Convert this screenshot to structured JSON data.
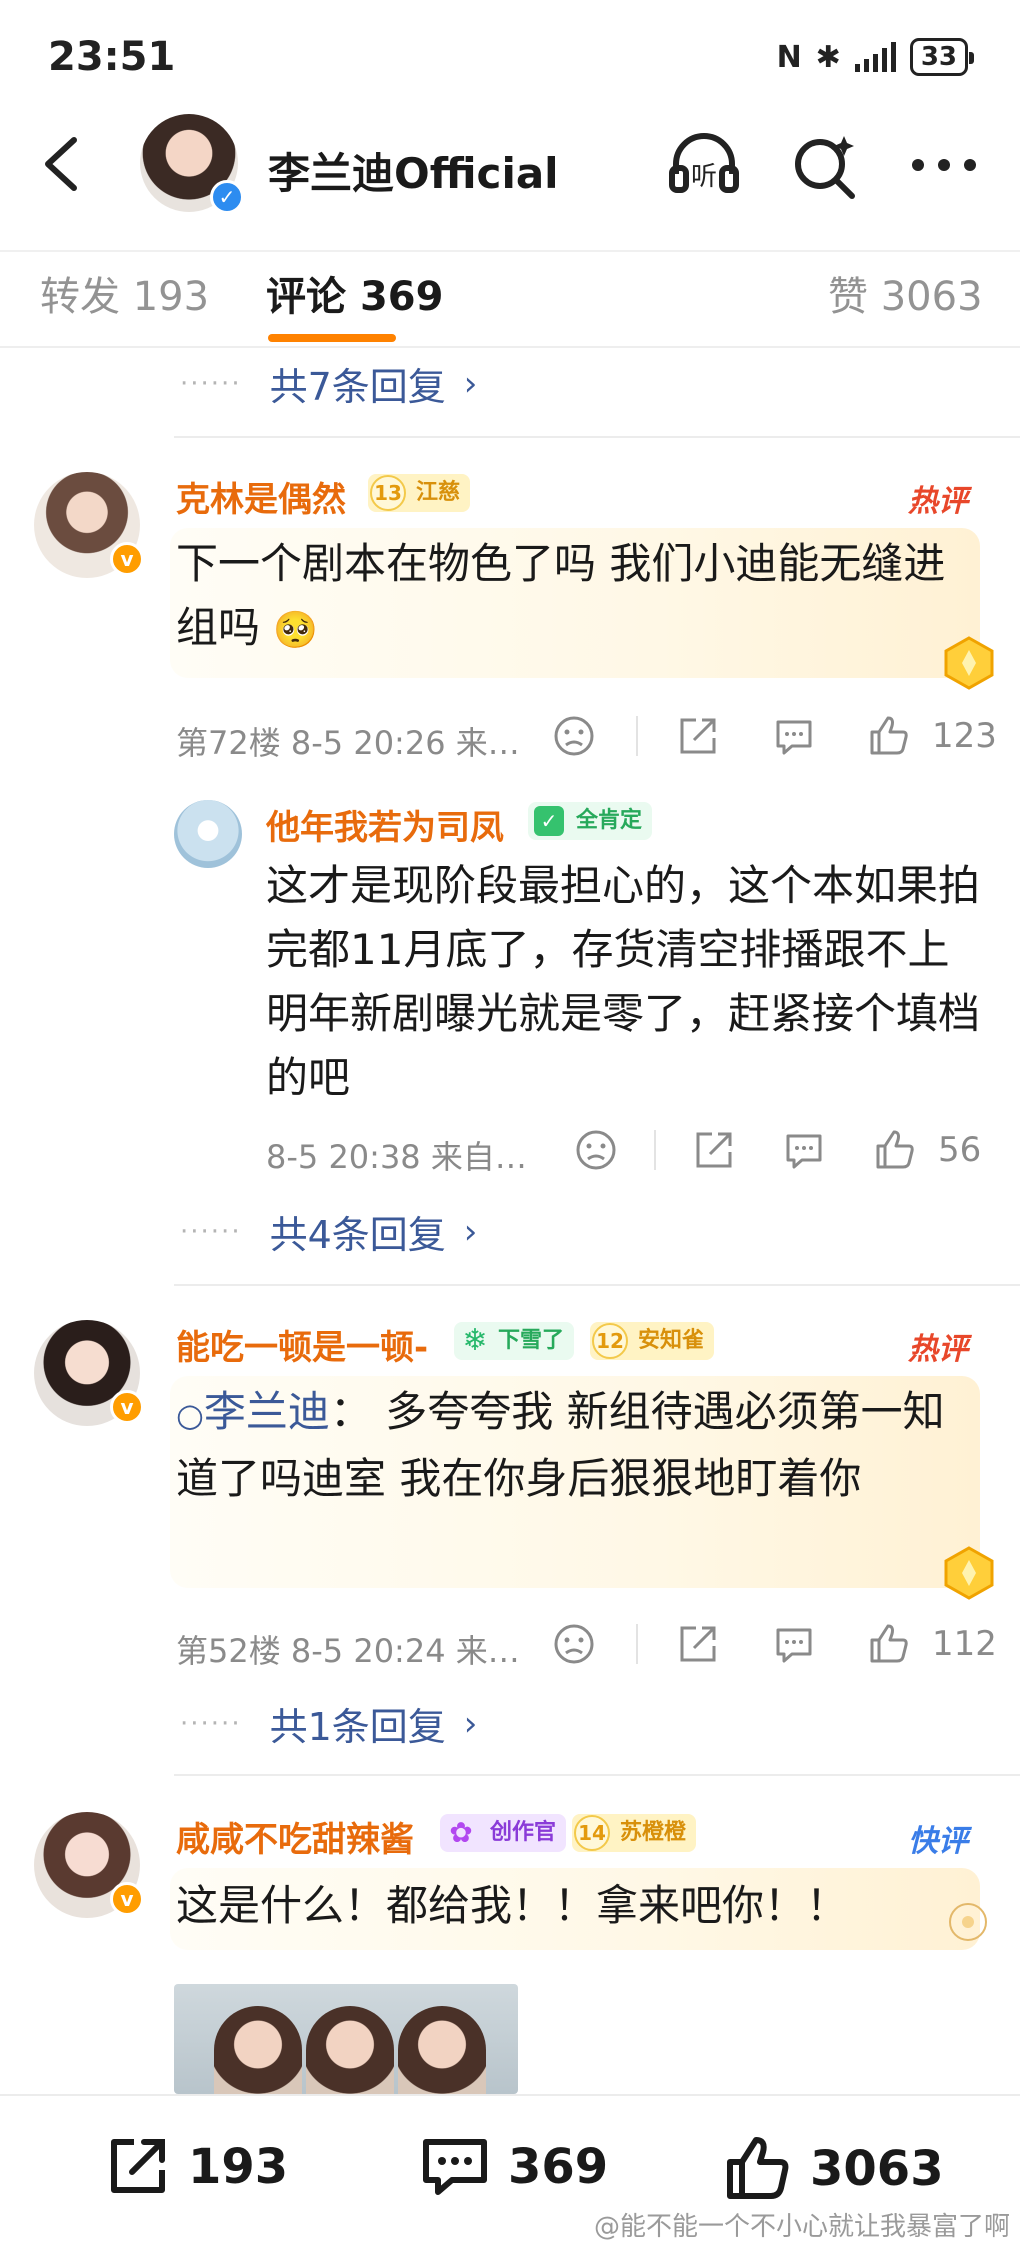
{
  "status_bar": {
    "time": "23:51",
    "battery": "33"
  },
  "header": {
    "title": "李兰迪Official"
  },
  "tabs": [
    {
      "label": "转发",
      "count": "193"
    },
    {
      "label": "评论",
      "count": "369"
    },
    {
      "label": "赞",
      "count": "3063"
    }
  ],
  "accent": "#ff8200",
  "replies_top": {
    "label": "共7条回复"
  },
  "comments": [
    {
      "username": "克林是偶然",
      "level": "13",
      "badge_name": "江慈",
      "tag": "热评",
      "text": "下一个剧本在物色了吗 我们小迪能无缝进组吗",
      "emoji": "🥺",
      "meta": "第72楼 8-5 20:26 来…",
      "likes": "123",
      "reply": {
        "username": "他年我若为司凤",
        "fan_badge": "全肯定",
        "text": "这才是现阶段最担心的，这个本如果拍完都11月底了，存货清空排播跟不上明年新剧曝光就是零了，赶紧接个填档的吧",
        "meta": "8-5 20:38 来自…",
        "likes": "56"
      },
      "replies_label": "共4条回复"
    },
    {
      "username": "能吃一顿是一顿-",
      "snow_badge": "下雪了",
      "level": "12",
      "badge_name": "安知雀",
      "tag": "热评",
      "mention": "李兰迪",
      "text": "： 多夸夸我 新组待遇必须第一知道了吗迪室 我在你身后狠狠地盯着你",
      "meta": "第52楼 8-5 20:24 来…",
      "likes": "112",
      "replies_label": "共1条回复"
    },
    {
      "username": "咸咸不吃甜辣酱",
      "creator_badge": "创作官",
      "level": "14",
      "badge_name": "苏橙橙",
      "tag": "快评",
      "text": "这是什么！都给我！！拿来吧你！！"
    }
  ],
  "bottom_bar": {
    "repost": "193",
    "comment": "369",
    "like": "3063"
  },
  "watermark": "@能不能一个不小心就让我暴富了啊"
}
